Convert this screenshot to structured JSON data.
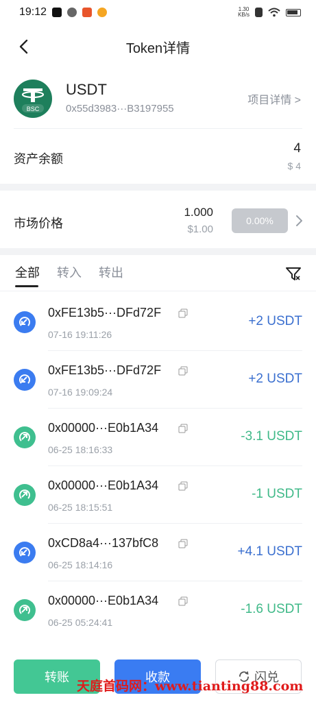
{
  "status_bar": {
    "time": "19:12",
    "net_speed_value": "1.30",
    "net_speed_unit": "KB/s"
  },
  "header": {
    "title": "Token详情"
  },
  "token": {
    "name": "USDT",
    "address": "0x55d3983···B3197955",
    "project_link": "项目详情 >",
    "logo_text": "BSC"
  },
  "balance": {
    "label": "资产余额",
    "amount": "4",
    "usd": "$ 4"
  },
  "market": {
    "label": "市场价格",
    "price": "1.000",
    "usd": "$1.00",
    "change": "0.00%"
  },
  "tabs": [
    {
      "label": "全部"
    },
    {
      "label": "转入"
    },
    {
      "label": "转出"
    }
  ],
  "transactions": [
    {
      "address": "0xFE13b5···DFd72F",
      "time": "07-16 19:11:26",
      "amount": "+2 USDT",
      "direction": "in"
    },
    {
      "address": "0xFE13b5···DFd72F",
      "time": "07-16 19:09:24",
      "amount": "+2 USDT",
      "direction": "in"
    },
    {
      "address": "0x00000···E0b1A34",
      "time": "06-25 18:16:33",
      "amount": "-3.1 USDT",
      "direction": "out"
    },
    {
      "address": "0x00000···E0b1A34",
      "time": "06-25 18:15:51",
      "amount": "-1 USDT",
      "direction": "out"
    },
    {
      "address": "0xCD8a4···137bfC8",
      "time": "06-25 18:14:16",
      "amount": "+4.1 USDT",
      "direction": "in"
    },
    {
      "address": "0x00000···E0b1A34",
      "time": "06-25 05:24:41",
      "amount": "-1.6 USDT",
      "direction": "out"
    }
  ],
  "actions": {
    "transfer": "转账",
    "receive": "收款",
    "swap": "闪兑"
  },
  "watermark": "天庭首码网：www.tianting88.com",
  "colors": {
    "in": "#3b7cf0",
    "out": "#3fbf8f",
    "transfer_btn": "#43c794",
    "receive_btn": "#3a7cf2",
    "token_logo": "#1e7f5c"
  }
}
